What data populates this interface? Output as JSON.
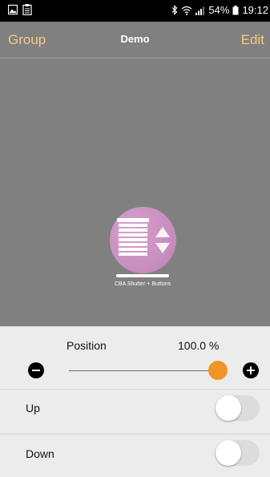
{
  "status_bar": {
    "left_icons": [
      "image-icon",
      "clipboard-icon"
    ],
    "right_icons": [
      "bluetooth-icon",
      "wifi-icon",
      "signal-icon",
      "battery-icon"
    ],
    "battery": "54%",
    "time": "19:12"
  },
  "nav": {
    "left_label": "Group",
    "title": "Demo",
    "right_label": "Edit"
  },
  "device": {
    "icon": "shutter-with-arrows-icon",
    "label": "CBA Shutter + Buttons",
    "color": "#c98fbf"
  },
  "controls": {
    "position_label": "Position",
    "position_value": "100.0 %",
    "position_percent": 100,
    "accent_color": "#ef9527",
    "up_label": "Up",
    "up_on": false,
    "down_label": "Down",
    "down_on": false
  }
}
